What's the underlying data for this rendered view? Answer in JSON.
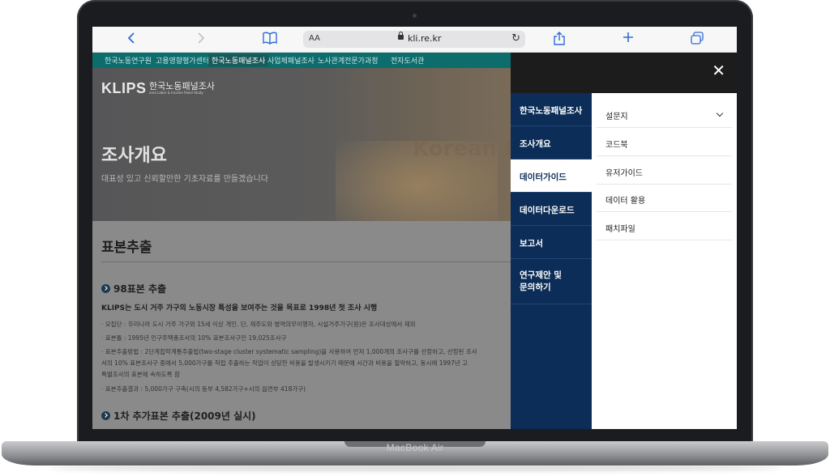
{
  "device": {
    "brand": "MacBook Air"
  },
  "browser": {
    "text_size_label": "AA",
    "url": "kli.re.kr",
    "icons": [
      "chevron-left-icon",
      "chevron-right-icon",
      "book-icon",
      "lock-icon",
      "reload-icon",
      "share-icon",
      "plus-icon",
      "tabs-icon"
    ]
  },
  "site": {
    "topnav": [
      "한국노동연구원",
      "고용영향평가센터",
      "한국노동패널조사",
      "사업체패널조사",
      "노사관계전문가과정",
      "전자도서관"
    ],
    "topnav_active_index": 2,
    "logo": {
      "text": "KLIPS",
      "kr": "한국노동패널조사",
      "sub": "orea Labor & Income Panel Study"
    },
    "hero": {
      "title": "조사개요",
      "subtitle": "대표성 있고 신뢰할만한 기초자료를 만들겠습니다",
      "watermark": "Korean L"
    },
    "section_title": "표본추출",
    "subsections": [
      {
        "heading": "98표본 추출"
      },
      {
        "heading": "1차 추가표본 추출(2009년 실시)"
      }
    ],
    "lead": "KLIPS는 도시 거주 가구의 노동시장 특성을 보여주는 것을 목표로 1998년 첫 조사 시행",
    "items": [
      "· 모집단 : 우리나라 도시 거주 가구와 15세 이상 개인. 단, 제주도와 병역의무이행자, 시설거주가구(원)은 조사대상에서 제외",
      "· 표본틀 : 1995년 인구주택총조사의 10% 표본조사구인 19,025조사구",
      "· 표본추출방법 : 2단계집락계통추출법(two-stage cluster systematic sampling)을 사용하여 먼저 1,000개의 조사구를 선정하고, 선정된 조사",
      "  서의 10% 표본조사구 중에서 5,000가구를 직접 추출하는 작업이 상당한 비용을 발생시키기 때문에 시간과 비용을 절약하고, 동시에 1997년 고",
      "  특별조사의 표본에 속하도록 함",
      "· 표본추출결과 : 5,000가구 구축(시의 동부 4,582가구+시의 읍면부 418가구)"
    ]
  },
  "menu": {
    "close_label": "✕",
    "categories": [
      "한국노동패널조사",
      "조사개요",
      "데이터가이드",
      "데이터다운로드",
      "보고서",
      "연구제안 및\n문의하기"
    ],
    "active_category_index": 2,
    "subitems": [
      "설문지",
      "코드북",
      "유저가이드",
      "데이터 활용",
      "패치파일"
    ],
    "expandable_subitem_index": 0
  }
}
